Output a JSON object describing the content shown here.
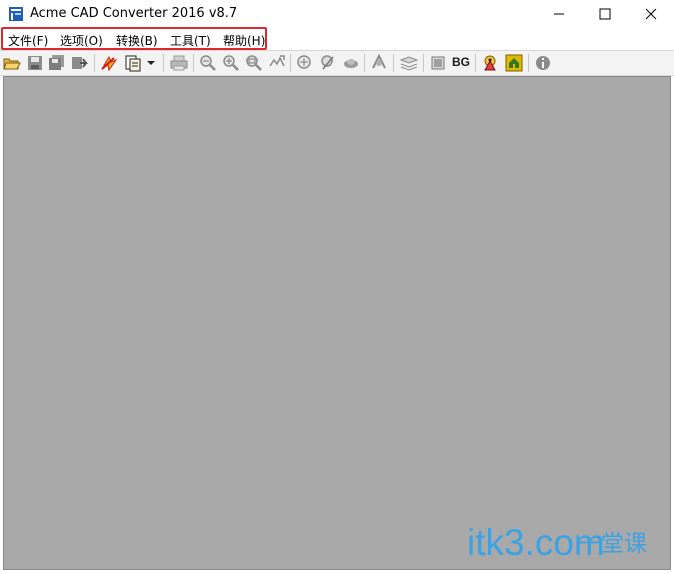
{
  "window": {
    "title": "Acme CAD Converter 2016 v8.7",
    "controls": [
      "minimize-icon",
      "maximize-icon",
      "close-icon"
    ]
  },
  "menu": {
    "items": [
      {
        "label": "文件(F)"
      },
      {
        "label": "选项(O)"
      },
      {
        "label": "转换(B)"
      },
      {
        "label": "工具(T)"
      },
      {
        "label": "帮助(H)"
      }
    ],
    "highlight_color": "#e0262e"
  },
  "toolbar": {
    "bg_label": "BG",
    "icons": [
      "open-folder-icon",
      "save-icon",
      "save-all-icon",
      "export-icon",
      "batch-convert-icon",
      "copy-to-clipboard-icon",
      "dropdown-arrow-icon",
      "print-icon",
      "zoom-out-icon",
      "zoom-in-icon",
      "zoom-window-icon",
      "zoom-extents-icon",
      "pan-icon",
      "zoom-realtime-icon",
      "view-3d-icon",
      "layers-icon",
      "layout-icon",
      "background-toggle-icon",
      "pen-settings-icon",
      "home-icon",
      "about-icon"
    ]
  },
  "canvas": {
    "background": "#a9a9a9"
  },
  "watermark": {
    "latin": "itk3.com",
    "cn": "一堂课",
    "color": "#3ba3e4"
  }
}
